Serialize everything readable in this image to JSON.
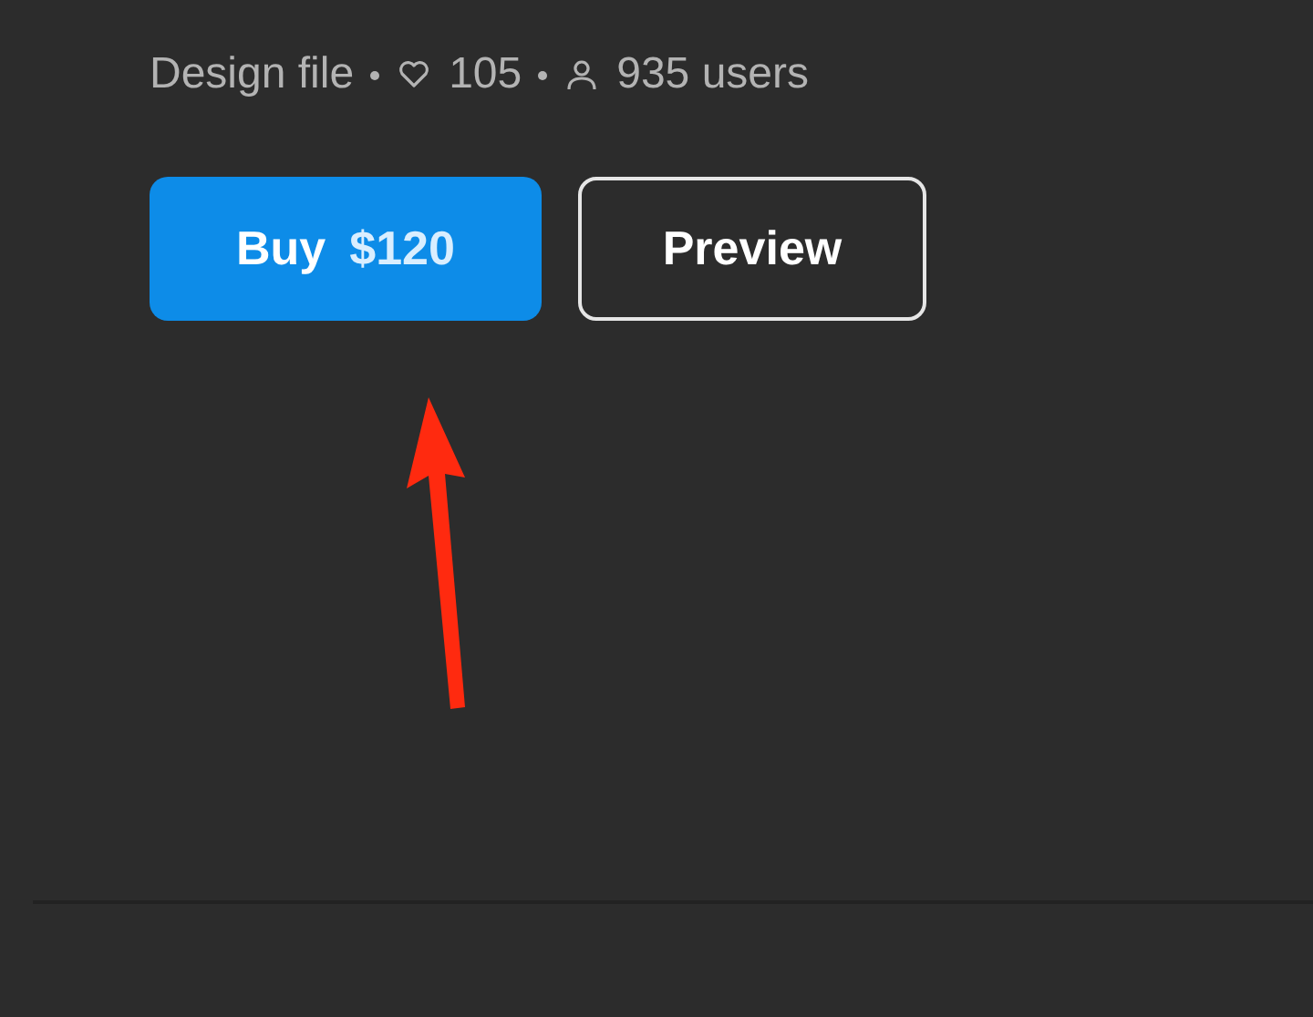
{
  "meta": {
    "type": "Design file",
    "likes": "105",
    "users": "935 users"
  },
  "buttons": [
    {
      "kind": "primary",
      "label": "Buy",
      "price": "$120"
    },
    {
      "kind": "outline",
      "label": "Preview"
    }
  ]
}
